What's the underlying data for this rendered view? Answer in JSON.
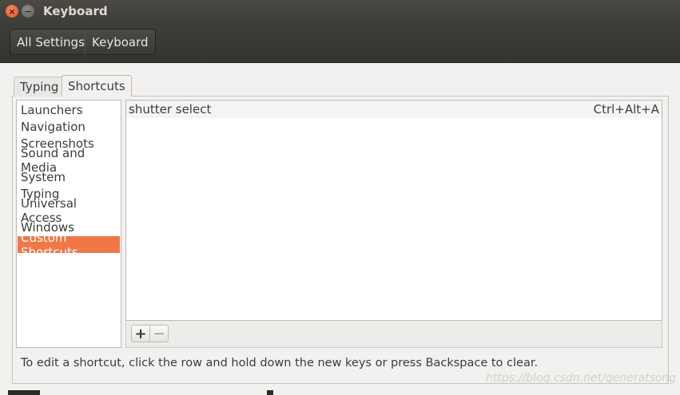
{
  "window": {
    "title": "Keyboard",
    "close_glyph": "×",
    "minimize_glyph": "−"
  },
  "breadcrumb": {
    "all_settings": "All Settings",
    "current": "Keyboard"
  },
  "tabs": [
    {
      "label": "Typing",
      "active": false
    },
    {
      "label": "Shortcuts",
      "active": true
    }
  ],
  "categories": [
    {
      "label": "Launchers",
      "selected": false
    },
    {
      "label": "Navigation",
      "selected": false
    },
    {
      "label": "Screenshots",
      "selected": false
    },
    {
      "label": "Sound and Media",
      "selected": false
    },
    {
      "label": "System",
      "selected": false
    },
    {
      "label": "Typing",
      "selected": false
    },
    {
      "label": "Universal Access",
      "selected": false
    },
    {
      "label": "Windows",
      "selected": false
    },
    {
      "label": "Custom Shortcuts",
      "selected": true
    }
  ],
  "shortcuts": [
    {
      "name": "shutter select",
      "accelerator": "Ctrl+Alt+A"
    }
  ],
  "list_toolbar": {
    "add_glyph": "+",
    "remove_glyph": "−"
  },
  "hint": "To edit a shortcut, click the row and hold down the new keys or press Backspace to clear.",
  "watermark": "https://blog.csdn.net/generatsong",
  "colors": {
    "accent": "#f07746",
    "titlebar": "#3e3d39",
    "window_bg": "#f2f1f0"
  }
}
